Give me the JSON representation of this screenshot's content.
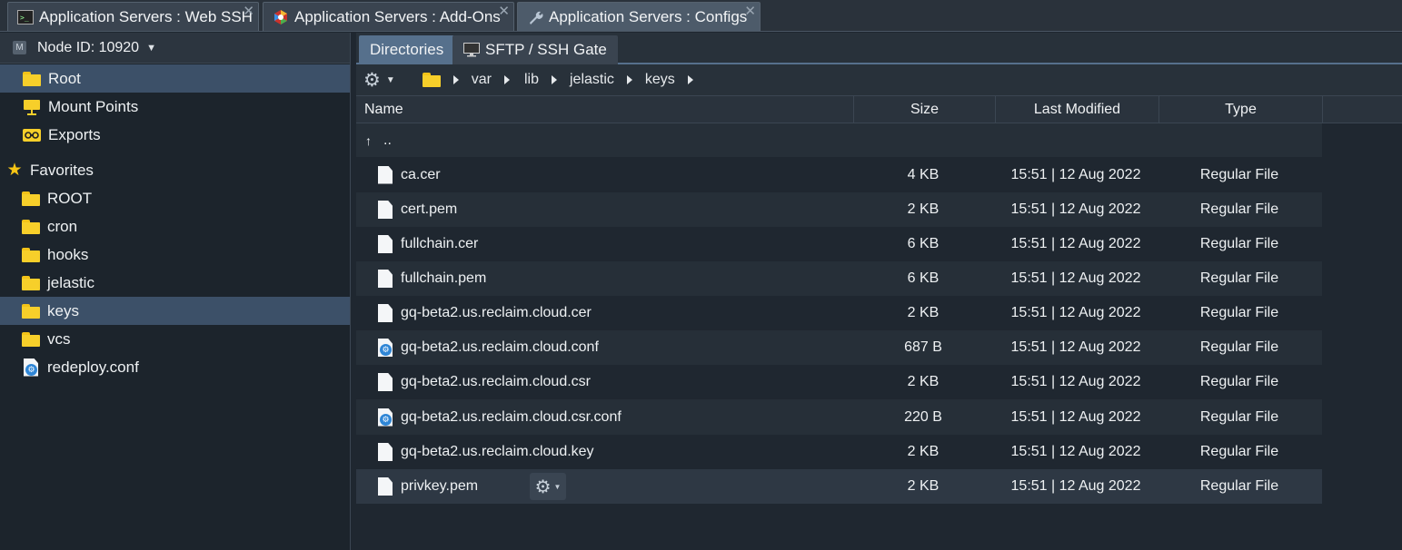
{
  "top_tabs": [
    {
      "label": "Application Servers : Web SSH",
      "icon": "terminal-icon"
    },
    {
      "label": "Application Servers : Add-Ons",
      "icon": "addons-icon"
    },
    {
      "label": "Application Servers : Configs",
      "icon": "wrench-icon"
    }
  ],
  "close_glyph": "✕",
  "node": {
    "label": "Node ID: 10920",
    "badge": "M"
  },
  "tree": {
    "root": "Root",
    "mount_points": "Mount Points",
    "exports": "Exports",
    "favorites": "Favorites",
    "favorites_items": [
      "ROOT",
      "cron",
      "hooks",
      "jelastic",
      "keys",
      "vcs",
      "redeploy.conf"
    ]
  },
  "sub_tabs": {
    "directories": "Directories",
    "sftp": "SFTP / SSH Gate"
  },
  "breadcrumb": [
    "var",
    "lib",
    "jelastic",
    "keys"
  ],
  "columns": {
    "name": "Name",
    "size": "Size",
    "modified": "Last Modified",
    "type": "Type"
  },
  "parent_row": {
    "glyph": "↑",
    "label": ".."
  },
  "files": [
    {
      "name": "ca.cer",
      "size": "4 KB",
      "modified": "15:51 | 12 Aug 2022",
      "type": "Regular File",
      "conf": false
    },
    {
      "name": "cert.pem",
      "size": "2 KB",
      "modified": "15:51 | 12 Aug 2022",
      "type": "Regular File",
      "conf": false
    },
    {
      "name": "fullchain.cer",
      "size": "6 KB",
      "modified": "15:51 | 12 Aug 2022",
      "type": "Regular File",
      "conf": false
    },
    {
      "name": "fullchain.pem",
      "size": "6 KB",
      "modified": "15:51 | 12 Aug 2022",
      "type": "Regular File",
      "conf": false
    },
    {
      "name": "gq-beta2.us.reclaim.cloud.cer",
      "size": "2 KB",
      "modified": "15:51 | 12 Aug 2022",
      "type": "Regular File",
      "conf": false
    },
    {
      "name": "gq-beta2.us.reclaim.cloud.conf",
      "size": "687 B",
      "modified": "15:51 | 12 Aug 2022",
      "type": "Regular File",
      "conf": true
    },
    {
      "name": "gq-beta2.us.reclaim.cloud.csr",
      "size": "2 KB",
      "modified": "15:51 | 12 Aug 2022",
      "type": "Regular File",
      "conf": false
    },
    {
      "name": "gq-beta2.us.reclaim.cloud.csr.conf",
      "size": "220 B",
      "modified": "15:51 | 12 Aug 2022",
      "type": "Regular File",
      "conf": true
    },
    {
      "name": "gq-beta2.us.reclaim.cloud.key",
      "size": "2 KB",
      "modified": "15:51 | 12 Aug 2022",
      "type": "Regular File",
      "conf": false
    },
    {
      "name": "privkey.pem",
      "size": "2 KB",
      "modified": "15:51 | 12 Aug 2022",
      "type": "Regular File",
      "conf": false
    }
  ],
  "colors": {
    "accent": "#56708c",
    "selection": "#3c5068",
    "folder": "#f7cf2a"
  }
}
